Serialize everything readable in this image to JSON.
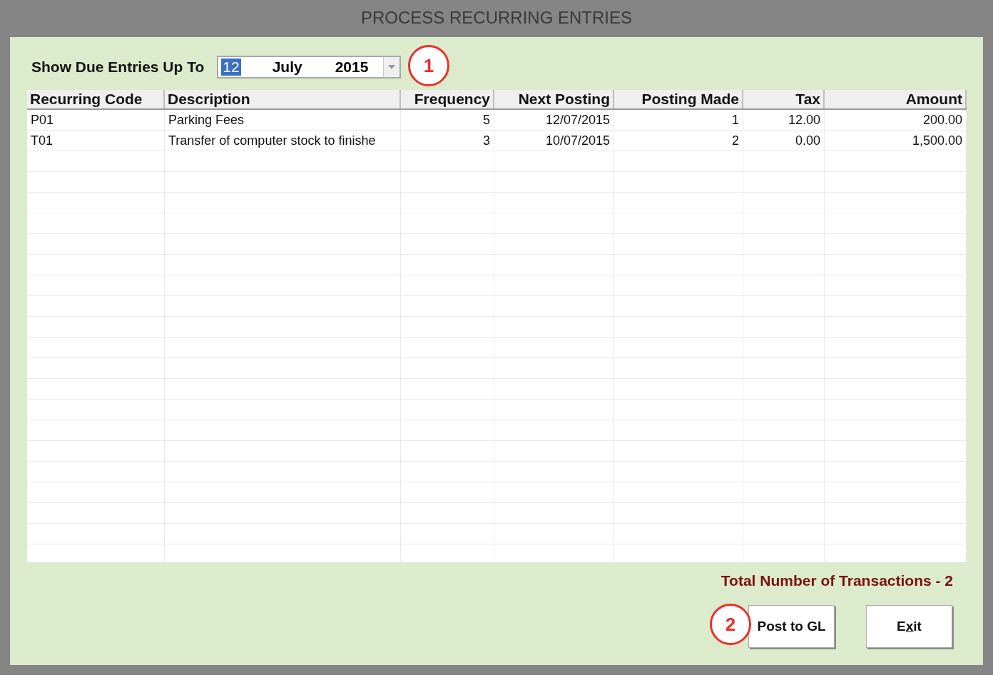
{
  "window": {
    "title": "PROCESS RECURRING ENTRIES"
  },
  "filter": {
    "label": "Show Due Entries Up To",
    "date": {
      "day": "12",
      "month": "July",
      "year": "2015",
      "day_selected": true
    }
  },
  "table": {
    "columns": [
      "Recurring Code",
      "Description",
      "Frequency",
      "Next Posting",
      "Posting Made",
      "Tax",
      "Amount"
    ],
    "rows": [
      [
        "P01",
        "Parking Fees",
        "5",
        "12/07/2015",
        "1",
        "12.00",
        "200.00"
      ],
      [
        "T01",
        "Transfer of computer stock to finishe",
        "3",
        "10/07/2015",
        "2",
        "0.00",
        "1,500.00"
      ]
    ]
  },
  "summary": "Total Number of Transactions - 2",
  "buttons": [
    {
      "label": "Post to GL",
      "kind": "plain"
    },
    {
      "label": "Exit",
      "kind": "mnemonic"
    }
  ],
  "annotations": [
    {
      "label": "1"
    },
    {
      "label": "2"
    }
  ]
}
